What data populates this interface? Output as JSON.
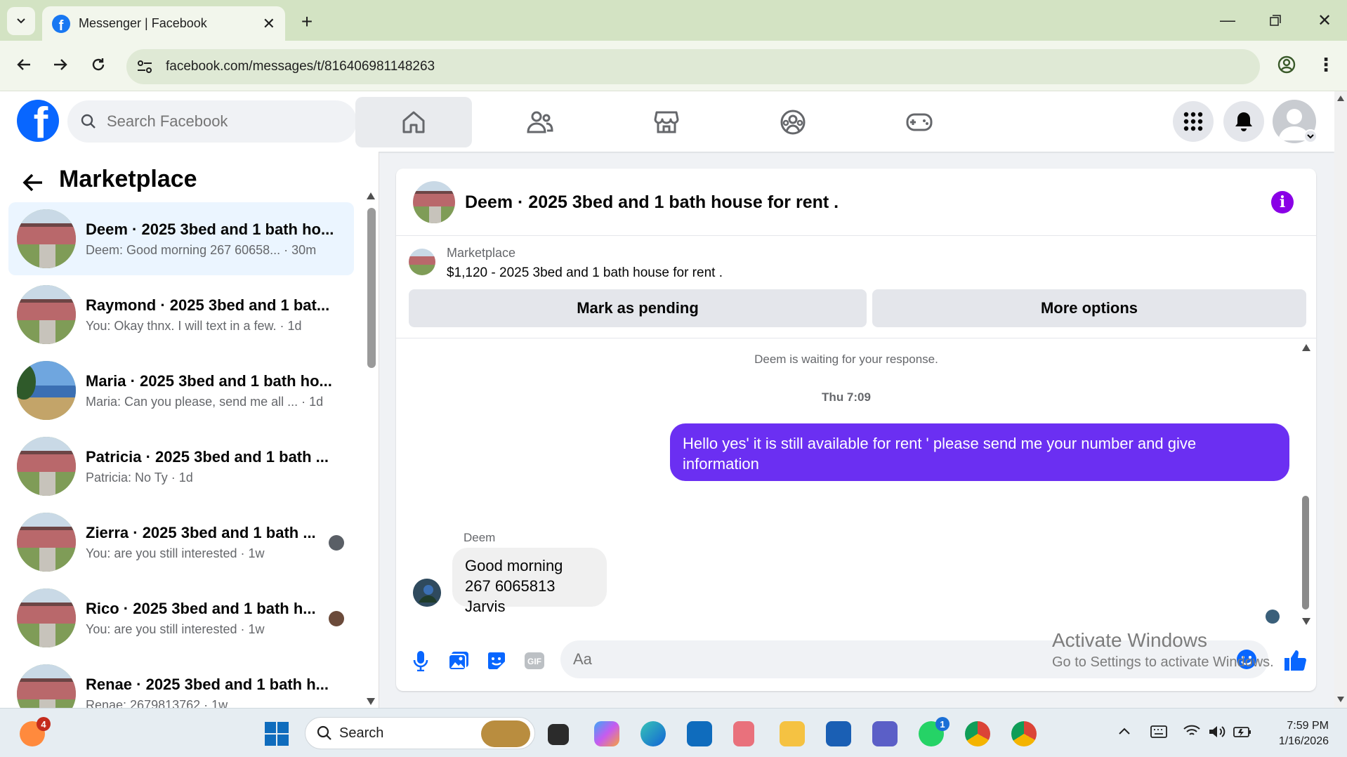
{
  "browser": {
    "tab_title": "Messenger | Facebook",
    "url": "facebook.com/messages/t/816406981148263"
  },
  "fb": {
    "search_placeholder": "Search Facebook"
  },
  "left": {
    "title": "Marketplace",
    "conversations": [
      {
        "name": "Deem · 2025 3bed and 1 bath ho...",
        "preview": "Deem: Good morning 267 60658... · 30m",
        "avatar": "house"
      },
      {
        "name": "Raymond · 2025 3bed and 1 bat...",
        "preview": "You: Okay thnx. I will text in a few. · 1d",
        "avatar": "house"
      },
      {
        "name": "Maria · 2025 3bed and 1 bath ho...",
        "preview": "Maria: Can you please, send me all ... · 1d",
        "avatar": "blue-house"
      },
      {
        "name": "Patricia · 2025 3bed and 1 bath ...",
        "preview": "Patricia: No Ty · 1d",
        "avatar": "house"
      },
      {
        "name": "Zierra · 2025 3bed and 1 bath ...",
        "preview": "You: are you still interested · 1w",
        "avatar": "house"
      },
      {
        "name": "Rico · 2025 3bed and 1 bath h...",
        "preview": "You: are you still interested · 1w",
        "avatar": "house"
      },
      {
        "name": "Renae · 2025 3bed and 1 bath h...",
        "preview": "Renae: 2679813762 · 1w",
        "avatar": "house"
      }
    ]
  },
  "chat": {
    "title": "Deem · 2025 3bed and 1 bath house for rent .",
    "listing_source": "Marketplace",
    "listing_desc": "$1,120 - 2025 3bed and 1 bath house for rent .",
    "btn_pending": "Mark as pending",
    "btn_more": "More options",
    "waiting": "Deem is waiting for your response.",
    "time": "Thu 7:09",
    "outgoing": "Hello yes' it is still available for rent ' please send me your number and give information",
    "sender": "Deem",
    "incoming_line1": "Good morning",
    "incoming_line2": "267 6065813 Jarvis",
    "composer_placeholder": "Aa"
  },
  "watermark": {
    "line1": "Activate Windows",
    "line2": "Go to Settings to activate Windows."
  },
  "taskbar": {
    "search": "Search",
    "badge_left": "4",
    "badge_whatsapp": "1",
    "time": "7:59 PM",
    "date": "1/16/2026"
  },
  "colors": {
    "fb_blue": "#0866ff",
    "messenger_purple": "#6b2ff2",
    "info_purple": "#8a00e6"
  }
}
